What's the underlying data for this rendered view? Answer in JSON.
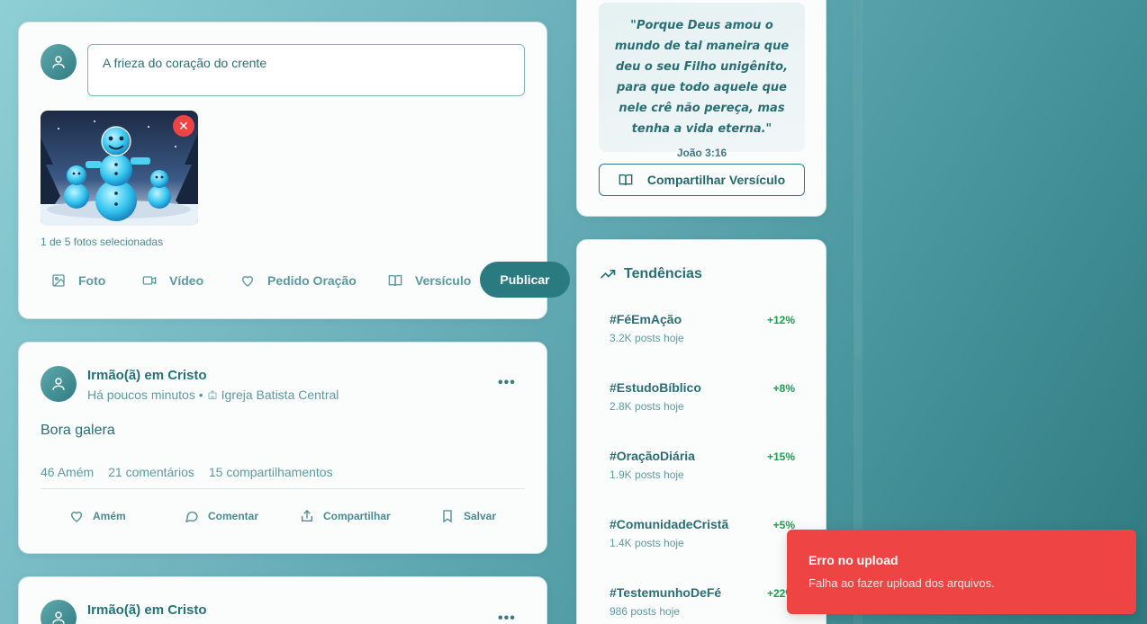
{
  "composer": {
    "input_value": "A frieza do coração do crente",
    "selected_count": "1 de 5 fotos selecionadas",
    "actions": [
      {
        "label": "Foto",
        "icon": "image-icon"
      },
      {
        "label": "Vídeo",
        "icon": "video-icon"
      },
      {
        "label": "Pedido Oração",
        "icon": "heart-icon"
      },
      {
        "label": "Versículo",
        "icon": "book-icon"
      }
    ],
    "publish_label": "Publicar"
  },
  "posts": [
    {
      "author": "Irmão(ã) em Cristo",
      "time": "Há poucos minutos •",
      "church": "Igreja Batista Central",
      "text": "Bora galera",
      "stats": {
        "amens": "46 Amém",
        "comments": "21 comentários",
        "shares": "15 compartilhamentos"
      },
      "actions": [
        {
          "label": "Amém",
          "icon": "heart-icon"
        },
        {
          "label": "Comentar",
          "icon": "comment-icon"
        },
        {
          "label": "Compartilhar",
          "icon": "share-icon"
        },
        {
          "label": "Salvar",
          "icon": "bookmark-icon"
        }
      ]
    },
    {
      "author": "Irmão(ã) em Cristo"
    }
  ],
  "verse": {
    "text": "\"Porque Deus amou o mundo de tal maneira que deu o seu Filho unigênito, para que todo aquele que nele crê não pereça, mas tenha a vida eterna.\"",
    "reference": "João 3:16",
    "share_label": "Compartilhar Versículo"
  },
  "trends": {
    "title": "Tendências",
    "items": [
      {
        "tag": "#FéEmAção",
        "growth": "+12%",
        "count": "3.2K posts hoje"
      },
      {
        "tag": "#EstudoBíblico",
        "growth": "+8%",
        "count": "2.8K posts hoje"
      },
      {
        "tag": "#OraçãoDiária",
        "growth": "+15%",
        "count": "1.9K posts hoje"
      },
      {
        "tag": "#ComunidadeCristã",
        "growth": "+5%",
        "count": "1.4K posts hoje"
      },
      {
        "tag": "#TestemunhoDeFé",
        "growth": "+22%",
        "count": "986 posts hoje"
      }
    ]
  },
  "toast": {
    "title": "Erro no upload",
    "message": "Falha ao fazer upload dos arquivos."
  },
  "colors": {
    "accent": "#2a7b80",
    "error": "#ef4444",
    "growth": "#16a34a"
  }
}
